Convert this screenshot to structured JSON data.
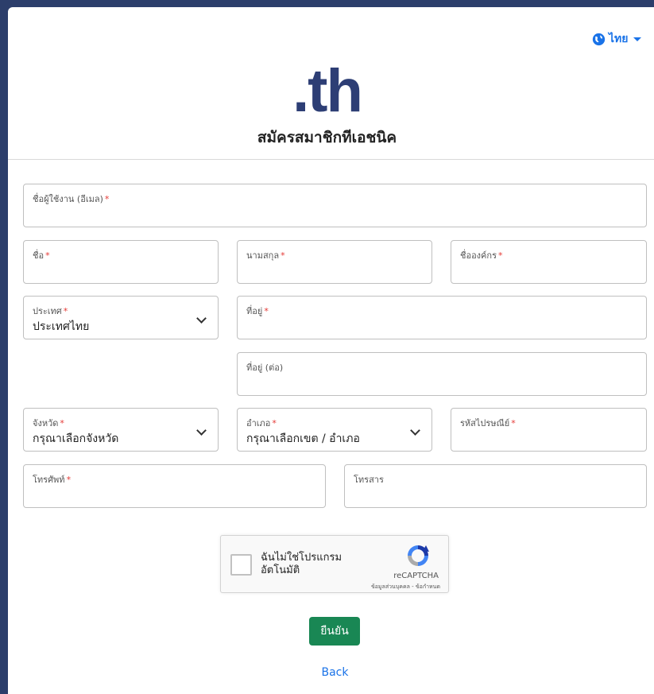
{
  "language": {
    "label": "ไทย",
    "icon": "globe-icon"
  },
  "logo": {
    "text": ".th"
  },
  "title": "สมัครสมาชิกทีเอชนิค",
  "form": {
    "username": {
      "label": "ชื่อผู้ใช้งาน (อีเมล)",
      "required": "*"
    },
    "first_name": {
      "label": "ชื่อ",
      "required": "*"
    },
    "last_name": {
      "label": "นามสกุล",
      "required": "*"
    },
    "organization": {
      "label": "ชื่อองค์กร",
      "required": "*"
    },
    "country": {
      "label": "ประเทศ",
      "required": "*",
      "value": "ประเทศไทย"
    },
    "address": {
      "label": "ที่อยู่",
      "required": "*"
    },
    "address2": {
      "label": "ที่อยู่ (ต่อ)"
    },
    "province": {
      "label": "จังหวัด",
      "required": "*",
      "value": "กรุณาเลือกจังหวัด"
    },
    "district": {
      "label": "อำเภอ",
      "required": "*",
      "value": "กรุณาเลือกเขต / อำเภอ"
    },
    "postal_code": {
      "label": "รหัสไปรษณีย์",
      "required": "*"
    },
    "phone": {
      "label": "โทรศัพท์",
      "required": "*"
    },
    "fax": {
      "label": "โทรสาร"
    }
  },
  "captcha": {
    "label": "ฉันไม่ใช่โปรแกรมอัตโนมัติ",
    "brand": "reCAPTCHA",
    "terms": "ข้อมูลส่วนบุคคล - ข้อกำหนด"
  },
  "submit_label": "ยืนยัน",
  "back_label": "Back",
  "colors": {
    "accent": "#1a73e8",
    "submit": "#198754",
    "logo": "#2d3e75",
    "required": "#e53935",
    "frame": "#2c3e6b"
  }
}
